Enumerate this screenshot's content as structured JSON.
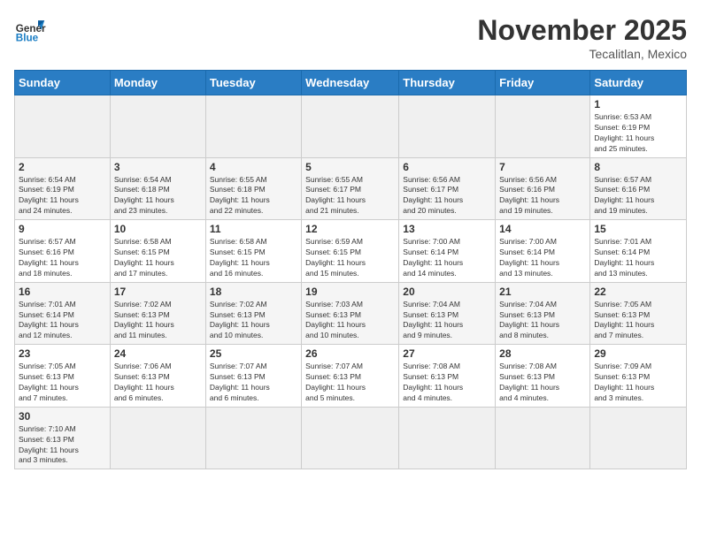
{
  "header": {
    "logo_general": "General",
    "logo_blue": "Blue",
    "month": "November 2025",
    "location": "Tecalitlan, Mexico"
  },
  "weekdays": [
    "Sunday",
    "Monday",
    "Tuesday",
    "Wednesday",
    "Thursday",
    "Friday",
    "Saturday"
  ],
  "weeks": [
    [
      {
        "day": "",
        "info": ""
      },
      {
        "day": "",
        "info": ""
      },
      {
        "day": "",
        "info": ""
      },
      {
        "day": "",
        "info": ""
      },
      {
        "day": "",
        "info": ""
      },
      {
        "day": "",
        "info": ""
      },
      {
        "day": "1",
        "info": "Sunrise: 6:53 AM\nSunset: 6:19 PM\nDaylight: 11 hours\nand 25 minutes."
      }
    ],
    [
      {
        "day": "2",
        "info": "Sunrise: 6:54 AM\nSunset: 6:19 PM\nDaylight: 11 hours\nand 24 minutes."
      },
      {
        "day": "3",
        "info": "Sunrise: 6:54 AM\nSunset: 6:18 PM\nDaylight: 11 hours\nand 23 minutes."
      },
      {
        "day": "4",
        "info": "Sunrise: 6:55 AM\nSunset: 6:18 PM\nDaylight: 11 hours\nand 22 minutes."
      },
      {
        "day": "5",
        "info": "Sunrise: 6:55 AM\nSunset: 6:17 PM\nDaylight: 11 hours\nand 21 minutes."
      },
      {
        "day": "6",
        "info": "Sunrise: 6:56 AM\nSunset: 6:17 PM\nDaylight: 11 hours\nand 20 minutes."
      },
      {
        "day": "7",
        "info": "Sunrise: 6:56 AM\nSunset: 6:16 PM\nDaylight: 11 hours\nand 19 minutes."
      },
      {
        "day": "8",
        "info": "Sunrise: 6:57 AM\nSunset: 6:16 PM\nDaylight: 11 hours\nand 19 minutes."
      }
    ],
    [
      {
        "day": "9",
        "info": "Sunrise: 6:57 AM\nSunset: 6:16 PM\nDaylight: 11 hours\nand 18 minutes."
      },
      {
        "day": "10",
        "info": "Sunrise: 6:58 AM\nSunset: 6:15 PM\nDaylight: 11 hours\nand 17 minutes."
      },
      {
        "day": "11",
        "info": "Sunrise: 6:58 AM\nSunset: 6:15 PM\nDaylight: 11 hours\nand 16 minutes."
      },
      {
        "day": "12",
        "info": "Sunrise: 6:59 AM\nSunset: 6:15 PM\nDaylight: 11 hours\nand 15 minutes."
      },
      {
        "day": "13",
        "info": "Sunrise: 7:00 AM\nSunset: 6:14 PM\nDaylight: 11 hours\nand 14 minutes."
      },
      {
        "day": "14",
        "info": "Sunrise: 7:00 AM\nSunset: 6:14 PM\nDaylight: 11 hours\nand 13 minutes."
      },
      {
        "day": "15",
        "info": "Sunrise: 7:01 AM\nSunset: 6:14 PM\nDaylight: 11 hours\nand 13 minutes."
      }
    ],
    [
      {
        "day": "16",
        "info": "Sunrise: 7:01 AM\nSunset: 6:14 PM\nDaylight: 11 hours\nand 12 minutes."
      },
      {
        "day": "17",
        "info": "Sunrise: 7:02 AM\nSunset: 6:13 PM\nDaylight: 11 hours\nand 11 minutes."
      },
      {
        "day": "18",
        "info": "Sunrise: 7:02 AM\nSunset: 6:13 PM\nDaylight: 11 hours\nand 10 minutes."
      },
      {
        "day": "19",
        "info": "Sunrise: 7:03 AM\nSunset: 6:13 PM\nDaylight: 11 hours\nand 10 minutes."
      },
      {
        "day": "20",
        "info": "Sunrise: 7:04 AM\nSunset: 6:13 PM\nDaylight: 11 hours\nand 9 minutes."
      },
      {
        "day": "21",
        "info": "Sunrise: 7:04 AM\nSunset: 6:13 PM\nDaylight: 11 hours\nand 8 minutes."
      },
      {
        "day": "22",
        "info": "Sunrise: 7:05 AM\nSunset: 6:13 PM\nDaylight: 11 hours\nand 7 minutes."
      }
    ],
    [
      {
        "day": "23",
        "info": "Sunrise: 7:05 AM\nSunset: 6:13 PM\nDaylight: 11 hours\nand 7 minutes."
      },
      {
        "day": "24",
        "info": "Sunrise: 7:06 AM\nSunset: 6:13 PM\nDaylight: 11 hours\nand 6 minutes."
      },
      {
        "day": "25",
        "info": "Sunrise: 7:07 AM\nSunset: 6:13 PM\nDaylight: 11 hours\nand 6 minutes."
      },
      {
        "day": "26",
        "info": "Sunrise: 7:07 AM\nSunset: 6:13 PM\nDaylight: 11 hours\nand 5 minutes."
      },
      {
        "day": "27",
        "info": "Sunrise: 7:08 AM\nSunset: 6:13 PM\nDaylight: 11 hours\nand 4 minutes."
      },
      {
        "day": "28",
        "info": "Sunrise: 7:08 AM\nSunset: 6:13 PM\nDaylight: 11 hours\nand 4 minutes."
      },
      {
        "day": "29",
        "info": "Sunrise: 7:09 AM\nSunset: 6:13 PM\nDaylight: 11 hours\nand 3 minutes."
      }
    ],
    [
      {
        "day": "30",
        "info": "Sunrise: 7:10 AM\nSunset: 6:13 PM\nDaylight: 11 hours\nand 3 minutes."
      },
      {
        "day": "",
        "info": ""
      },
      {
        "day": "",
        "info": ""
      },
      {
        "day": "",
        "info": ""
      },
      {
        "day": "",
        "info": ""
      },
      {
        "day": "",
        "info": ""
      },
      {
        "day": "",
        "info": ""
      }
    ]
  ]
}
